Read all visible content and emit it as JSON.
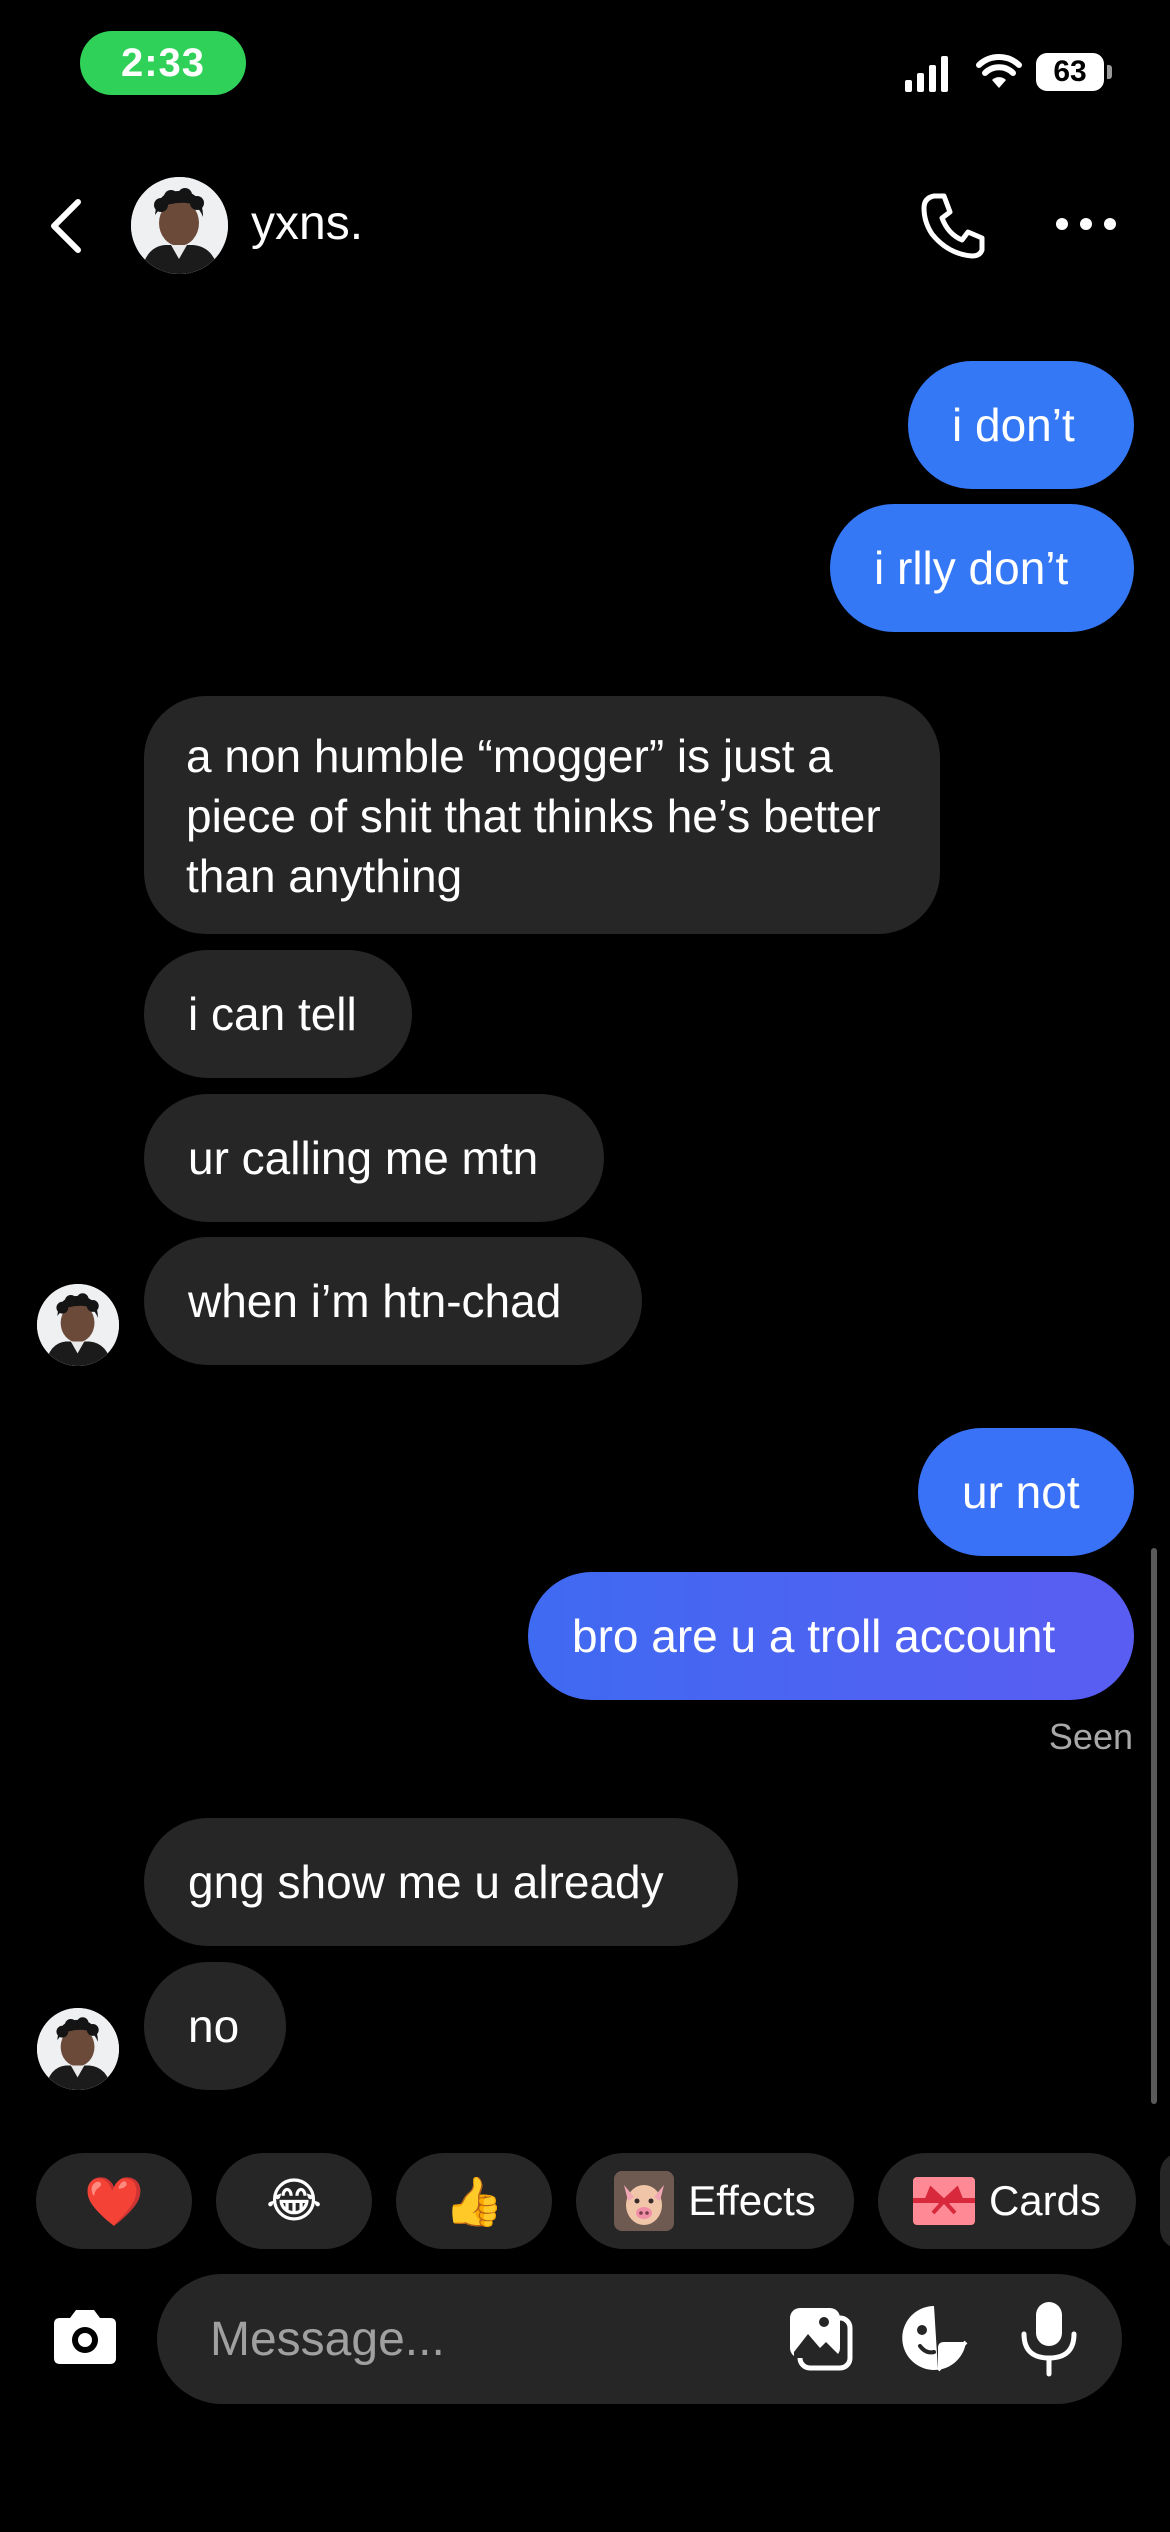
{
  "status_bar": {
    "time": "2:33",
    "battery": "63",
    "icons": [
      "signal-icon",
      "wifi-icon",
      "battery-icon"
    ]
  },
  "header": {
    "name": "yxns.",
    "icons": [
      "back-icon",
      "phone-icon",
      "more-icon"
    ]
  },
  "messages": [
    {
      "side": "out",
      "text": "i don’t"
    },
    {
      "side": "out",
      "text": "i rlly don’t"
    },
    {
      "side": "in",
      "text": "a non humble “mogger” is just a piece of shit that thinks he’s better than anything"
    },
    {
      "side": "in",
      "text": "i can tell"
    },
    {
      "side": "in",
      "text": "ur calling me mtn"
    },
    {
      "side": "in",
      "text": "when i’m htn-chad"
    },
    {
      "side": "out",
      "text": "ur not"
    },
    {
      "side": "out",
      "text": "bro are u a troll account"
    },
    {
      "side": "in",
      "text": "gng show me u already"
    },
    {
      "side": "in",
      "text": "no"
    }
  ],
  "seen_label": "Seen",
  "quick_replies": [
    {
      "emoji": "❤️"
    },
    {
      "emoji": "😂"
    },
    {
      "emoji": "👍"
    },
    {
      "icon": "effects-face-icon",
      "label": "Effects"
    },
    {
      "icon": "gift-card-icon",
      "label": "Cards"
    }
  ],
  "composer": {
    "placeholder": "Message...",
    "icons": [
      "camera-icon",
      "gallery-icon",
      "sticker-icon",
      "microphone-icon"
    ]
  },
  "colors": {
    "outgoing_bubble": "#3478f6",
    "incoming_bubble": "#262626",
    "time_pill": "#30d158"
  }
}
